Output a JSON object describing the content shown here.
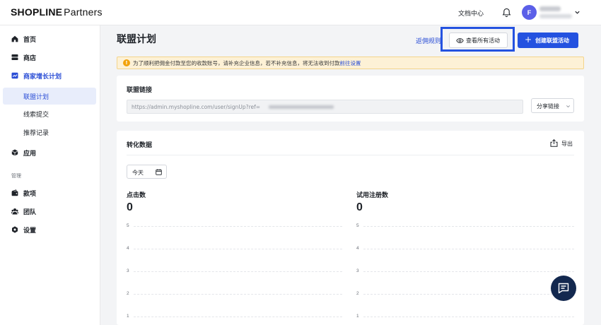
{
  "header": {
    "logo_bold": "SHOPLINE",
    "logo_light": "Partners",
    "docs_label": "文档中心",
    "avatar_initial": "F"
  },
  "sidebar": {
    "items": [
      {
        "label": "首页",
        "icon": "home-icon"
      },
      {
        "label": "商店",
        "icon": "store-icon"
      },
      {
        "label": "商家增长计划",
        "icon": "growth-chart-icon"
      },
      {
        "label": "联盟计划",
        "active": true
      },
      {
        "label": "线索提交"
      },
      {
        "label": "推荐记录"
      },
      {
        "label": "应用",
        "icon": "app-cube-icon"
      }
    ],
    "section_label": "管理",
    "manage_items": [
      {
        "label": "款项",
        "icon": "wallet-icon"
      },
      {
        "label": "团队",
        "icon": "team-icon"
      },
      {
        "label": "设置",
        "icon": "settings-icon"
      }
    ]
  },
  "main": {
    "title": "联盟计划",
    "rules_link": "返佣规则",
    "view_all_button": "查看所有活动",
    "create_button": "创建联盟活动",
    "notice_text": "为了顺利把佣金付款至您的收款账号，请补充企业信息，若不补充信息，将无法收到付款",
    "notice_link": "前往设置"
  },
  "link_card": {
    "title": "联盟链接",
    "url_prefix": "https://admin.myshopline.com/user/signUp?ref=",
    "share_button": "分享链接"
  },
  "conversion_card": {
    "title": "转化数据",
    "export_label": "导出",
    "date_filter": "今天",
    "metrics": [
      {
        "label": "点击数",
        "value": "0"
      },
      {
        "label": "试用注册数",
        "value": "0"
      }
    ],
    "y_ticks": [
      "5",
      "4",
      "3",
      "2",
      "1"
    ]
  },
  "chart_data": [
    {
      "type": "line",
      "title": "点击数",
      "yticks": [
        5,
        4,
        3,
        2,
        1
      ],
      "ylim": [
        0,
        5
      ],
      "series": [],
      "grid": true
    },
    {
      "type": "line",
      "title": "试用注册数",
      "yticks": [
        5,
        4,
        3,
        2,
        1
      ],
      "ylim": [
        0,
        5
      ],
      "series": [],
      "grid": true
    }
  ]
}
